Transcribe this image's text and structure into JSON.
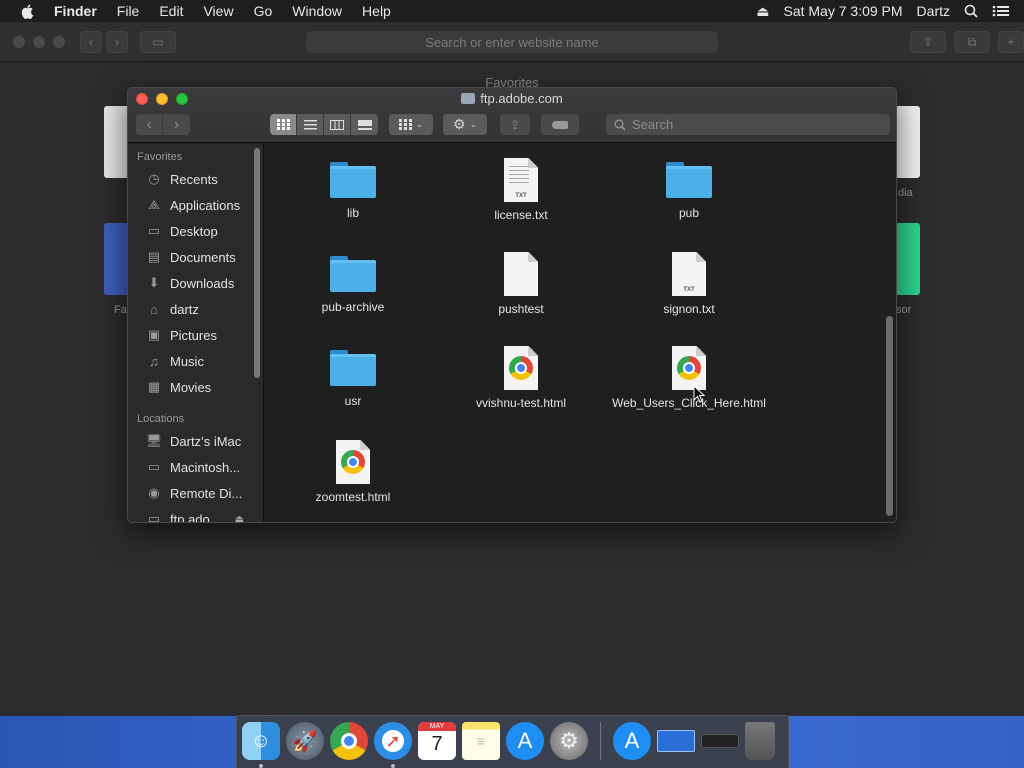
{
  "menubar": {
    "app_name": "Finder",
    "items": [
      "File",
      "Edit",
      "View",
      "Go",
      "Window",
      "Help"
    ],
    "clock": "Sat May 7  3:09 PM",
    "user": "Dartz"
  },
  "safari": {
    "url_placeholder": "Search or enter website name",
    "favorites_title": "Favorites",
    "bg_labels": [
      "Fa",
      "dia",
      "sor"
    ]
  },
  "finder": {
    "title": "ftp.adobe.com",
    "search_placeholder": "Search",
    "sidebar": {
      "favorites_heading": "Favorites",
      "favorites": [
        {
          "label": "Recents",
          "icon": "clock-icon"
        },
        {
          "label": "Applications",
          "icon": "applications-icon"
        },
        {
          "label": "Desktop",
          "icon": "desktop-icon"
        },
        {
          "label": "Documents",
          "icon": "documents-icon"
        },
        {
          "label": "Downloads",
          "icon": "downloads-icon"
        },
        {
          "label": "dartz",
          "icon": "home-icon"
        },
        {
          "label": "Pictures",
          "icon": "camera-icon"
        },
        {
          "label": "Music",
          "icon": "music-note-icon"
        },
        {
          "label": "Movies",
          "icon": "film-icon"
        }
      ],
      "locations_heading": "Locations",
      "locations": [
        {
          "label": "Dartz’s iMac",
          "icon": "imac-icon"
        },
        {
          "label": "Macintosh...",
          "icon": "disk-icon"
        },
        {
          "label": "Remote Di...",
          "icon": "dvd-icon"
        },
        {
          "label": "ftp.ado...",
          "icon": "server-icon"
        }
      ]
    },
    "files": [
      {
        "name": "lib",
        "kind": "folder"
      },
      {
        "name": "license.txt",
        "kind": "txt"
      },
      {
        "name": "pub",
        "kind": "folder"
      },
      {
        "name": "pub-archive",
        "kind": "folder"
      },
      {
        "name": "pushtest",
        "kind": "doc"
      },
      {
        "name": "signon.txt",
        "kind": "txt"
      },
      {
        "name": "usr",
        "kind": "folder"
      },
      {
        "name": "vvishnu-test.html",
        "kind": "html"
      },
      {
        "name": "Web_Users_Click_Here.html",
        "kind": "html"
      },
      {
        "name": "zoomtest.html",
        "kind": "html"
      }
    ],
    "txt_badge": "TXT"
  },
  "dock": {
    "month": "MAY",
    "day": "7"
  }
}
